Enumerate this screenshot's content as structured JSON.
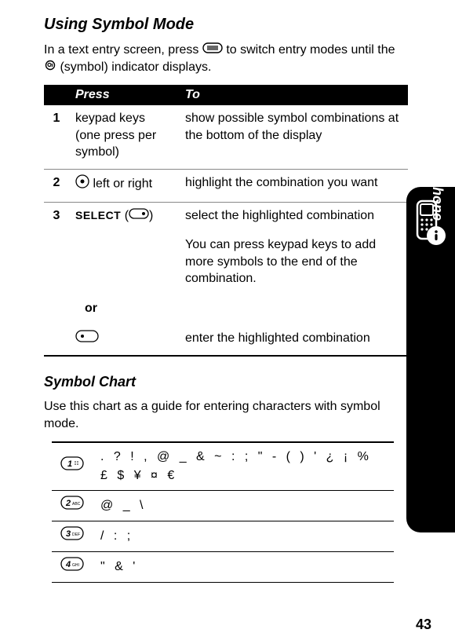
{
  "title": "Using Symbol Mode",
  "intro_before_icon": "In a text entry screen, press ",
  "intro_after_icon": " to switch entry modes until the ",
  "intro_after_symbol": " (symbol) indicator displays.",
  "table_header_press": "Press",
  "table_header_to": "To",
  "rows": [
    {
      "num": "1",
      "press": "keypad keys (one press per symbol)",
      "to": "show possible symbol combinations at the bottom of the display"
    },
    {
      "num": "2",
      "press": " left or right",
      "press_prefix_icon": true,
      "to": "highlight the combination you want"
    },
    {
      "num": "3",
      "press_label": "SELECT",
      "press_paren": "(",
      "press_paren_close": ")",
      "to": "select the highlighted combination"
    }
  ],
  "row3_note": "You can press keypad keys to add more symbols to the end of the combination.",
  "or_label": "or",
  "row_enter_to": "enter the highlighted combination",
  "chart_title": "Symbol Chart",
  "chart_intro": "Use this chart as a guide for entering characters with symbol mode.",
  "chart": [
    {
      "key": "1",
      "syms": ". ? ! , @ _ & ~ : ; \" - ( ) ' ¿ ¡ % £ $ ¥ ¤ €"
    },
    {
      "key": "2",
      "syms": "@ _ \\"
    },
    {
      "key": "3",
      "syms": "/ : ;"
    },
    {
      "key": "4",
      "syms": "\" & '"
    }
  ],
  "side_label": "Learning to Use Your Phone",
  "page_number": "43"
}
